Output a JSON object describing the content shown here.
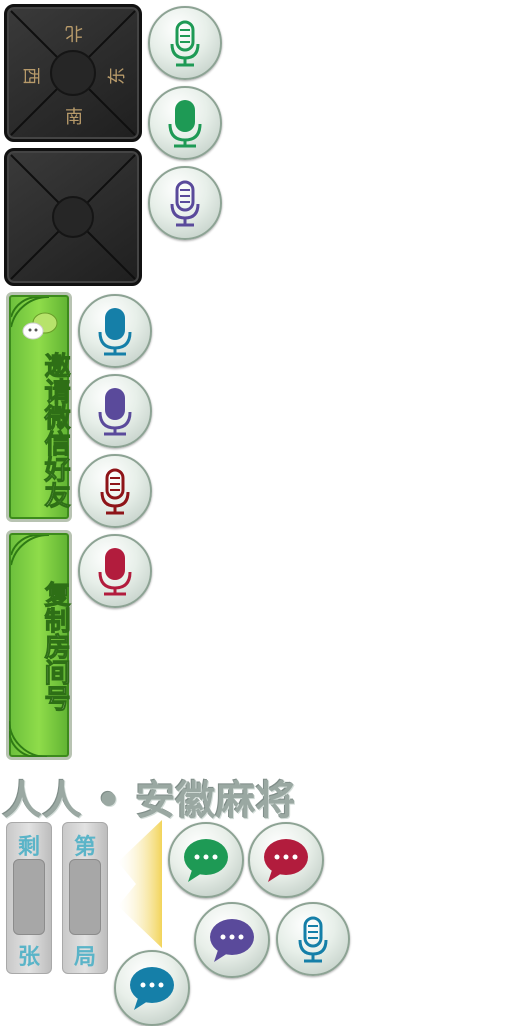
{
  "compass_tile_1": {
    "north": "北",
    "east": "东",
    "south": "南",
    "west": "西"
  },
  "invite_button": {
    "label": "邀请微信好友"
  },
  "copy_room_button": {
    "label": "复制房间号"
  },
  "title_banner": {
    "text": "人人 • 安徽麻将"
  },
  "left_panel": {
    "top_label": "剩",
    "bottom_label": "张"
  },
  "right_panel": {
    "top_label": "第",
    "bottom_label": "局"
  },
  "colors": {
    "green": "#1e9a55",
    "red": "#b21c3d",
    "purple": "#5a4a9b",
    "teal": "#157fa8",
    "darkred": "#8e1418"
  },
  "icons": [
    "microphone-icon",
    "chat-bubble-icon",
    "compass-icon",
    "wechat-icon"
  ]
}
